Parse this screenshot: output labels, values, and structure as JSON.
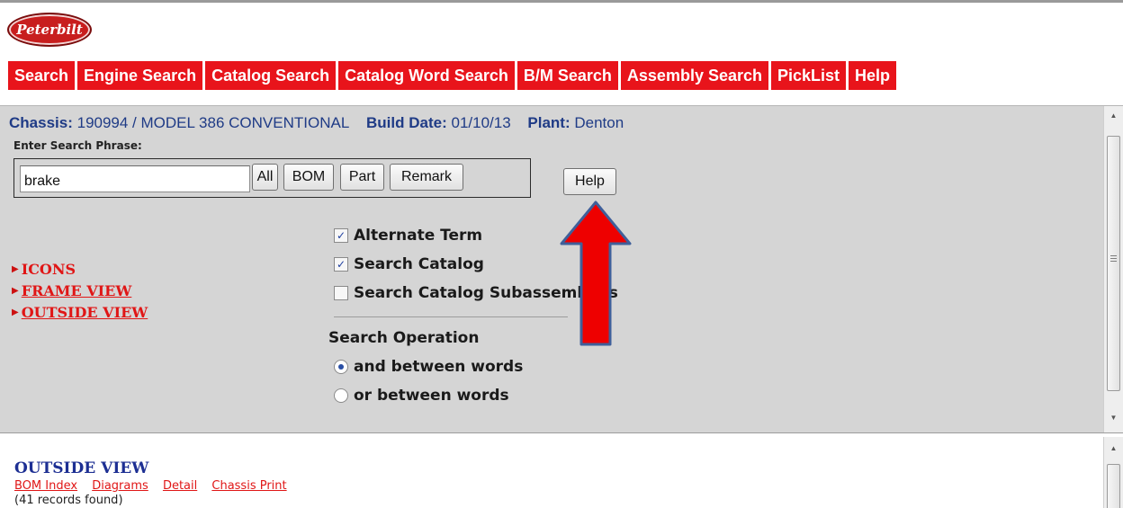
{
  "logo": {
    "text": "Peterbilt"
  },
  "menu": [
    "Search",
    "Engine Search",
    "Catalog Search",
    "Catalog Word Search",
    "B/M Search",
    "Assembly Search",
    "PickList",
    "Help"
  ],
  "info": {
    "chassis_label": "Chassis:",
    "chassis_value": "190994  / MODEL 386 CONVENTIONAL",
    "build_label": "Build Date:",
    "build_value": "01/10/13",
    "plant_label": "Plant:",
    "plant_value": "Denton"
  },
  "search": {
    "label": "Enter Search Phrase:",
    "value": "brake",
    "buttons": {
      "all": "All",
      "bom": "BOM",
      "part": "Part",
      "remark": "Remark",
      "help": "Help"
    }
  },
  "left_links": [
    "ICONS",
    "FRAME VIEW",
    "OUTSIDE VIEW"
  ],
  "options": {
    "checkboxes": [
      {
        "label": "Alternate Term",
        "checked": true
      },
      {
        "label": "Search Catalog",
        "checked": true
      },
      {
        "label": "Search Catalog Subassemblies",
        "checked": false
      }
    ],
    "operation_title": "Search Operation",
    "radios": [
      {
        "label": "and between words",
        "selected": true
      },
      {
        "label": "or between words",
        "selected": false
      }
    ]
  },
  "annotation": {
    "arrow_color": "#ee0000",
    "arrow_outline": "#3f5f9a",
    "points_to": "Help"
  },
  "results": {
    "title": "OUTSIDE VIEW",
    "links": [
      "BOM Index",
      "Diagrams",
      "Detail",
      "Chassis Print"
    ],
    "records": "(41 records found)"
  },
  "colors": {
    "menu_bg": "#e8141b",
    "panel_bg": "#d5d5d5",
    "info_text": "#1f3b86",
    "link_red": "#e01616"
  }
}
